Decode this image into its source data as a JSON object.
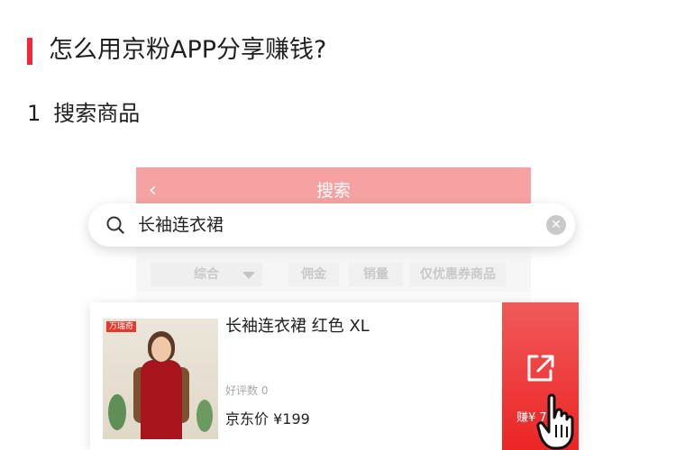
{
  "article": {
    "title": "怎么用京粉APP分享赚钱?",
    "step_number": "1",
    "step_title": "搜索商品"
  },
  "app": {
    "header_title": "搜索",
    "search": {
      "query": "长袖连衣裙"
    },
    "filters": [
      "综合",
      "佣金",
      "销量",
      "仅优惠券商品"
    ]
  },
  "product": {
    "brand_tag": "万瑞奇",
    "name": "长袖连衣裙 红色 XL",
    "reviews": "好评数 0",
    "price": "京东价 ¥199",
    "share_label": "赚¥  7"
  },
  "colors": {
    "accent": "#f2273a",
    "header": "#f7a2a2",
    "share_button": "#ec2424"
  }
}
